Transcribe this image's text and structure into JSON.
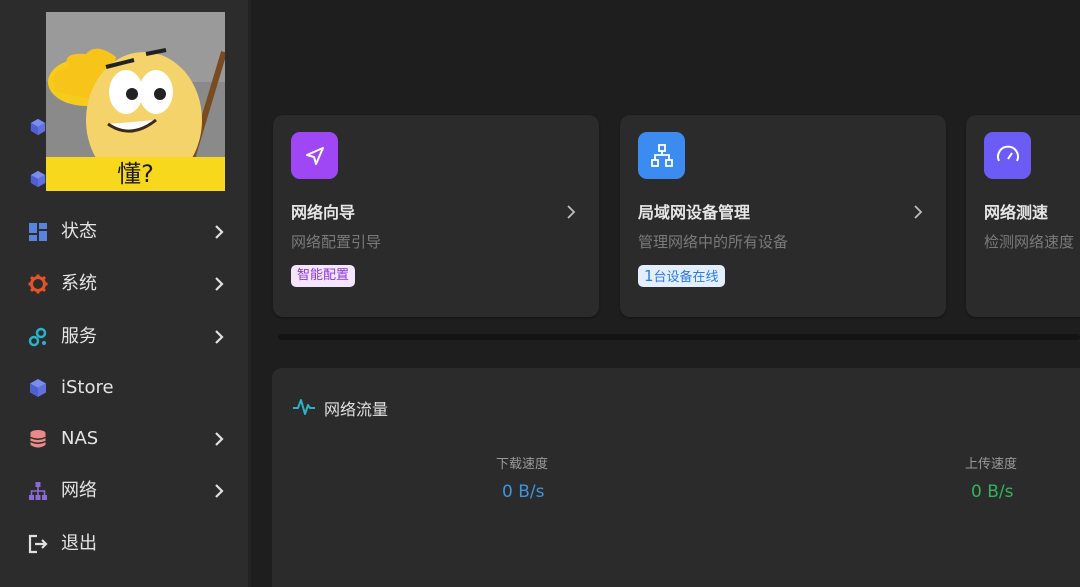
{
  "sidebar": {
    "sticker_caption": "懂?",
    "items": [
      {
        "label": "状态",
        "icon": "dashboard-icon"
      },
      {
        "label": "系统",
        "icon": "gear-icon"
      },
      {
        "label": "服务",
        "icon": "cogs-icon"
      },
      {
        "label": "iStore",
        "icon": "cube-icon"
      },
      {
        "label": "NAS",
        "icon": "database-icon"
      },
      {
        "label": "网络",
        "icon": "network-icon"
      },
      {
        "label": "退出",
        "icon": "logout-icon"
      }
    ]
  },
  "cards": [
    {
      "title": "网络向导",
      "subtitle": "网络配置引导",
      "badge": "智能配置",
      "icon": "navigation-icon",
      "icon_color": "#9f47f5"
    },
    {
      "title": "局域网设备管理",
      "subtitle": "管理网络中的所有设备",
      "badge_count": "1",
      "badge": "台设备在线",
      "icon": "lan-icon",
      "icon_color": "#3c8bf0"
    },
    {
      "title": "网络测速",
      "subtitle": "检测网络速度",
      "icon": "speedometer-icon",
      "icon_color": "#6a5cf5"
    }
  ],
  "traffic": {
    "title": "网络流量",
    "download_label": "下载速度",
    "download_value": "0 B/s",
    "upload_label": "上传速度",
    "upload_value": "0 B/s"
  },
  "colors": {
    "download": "#3f93e0",
    "upload": "#2fb55c",
    "accent_purple": "#9f47f5",
    "accent_blue": "#3c8bf0"
  }
}
